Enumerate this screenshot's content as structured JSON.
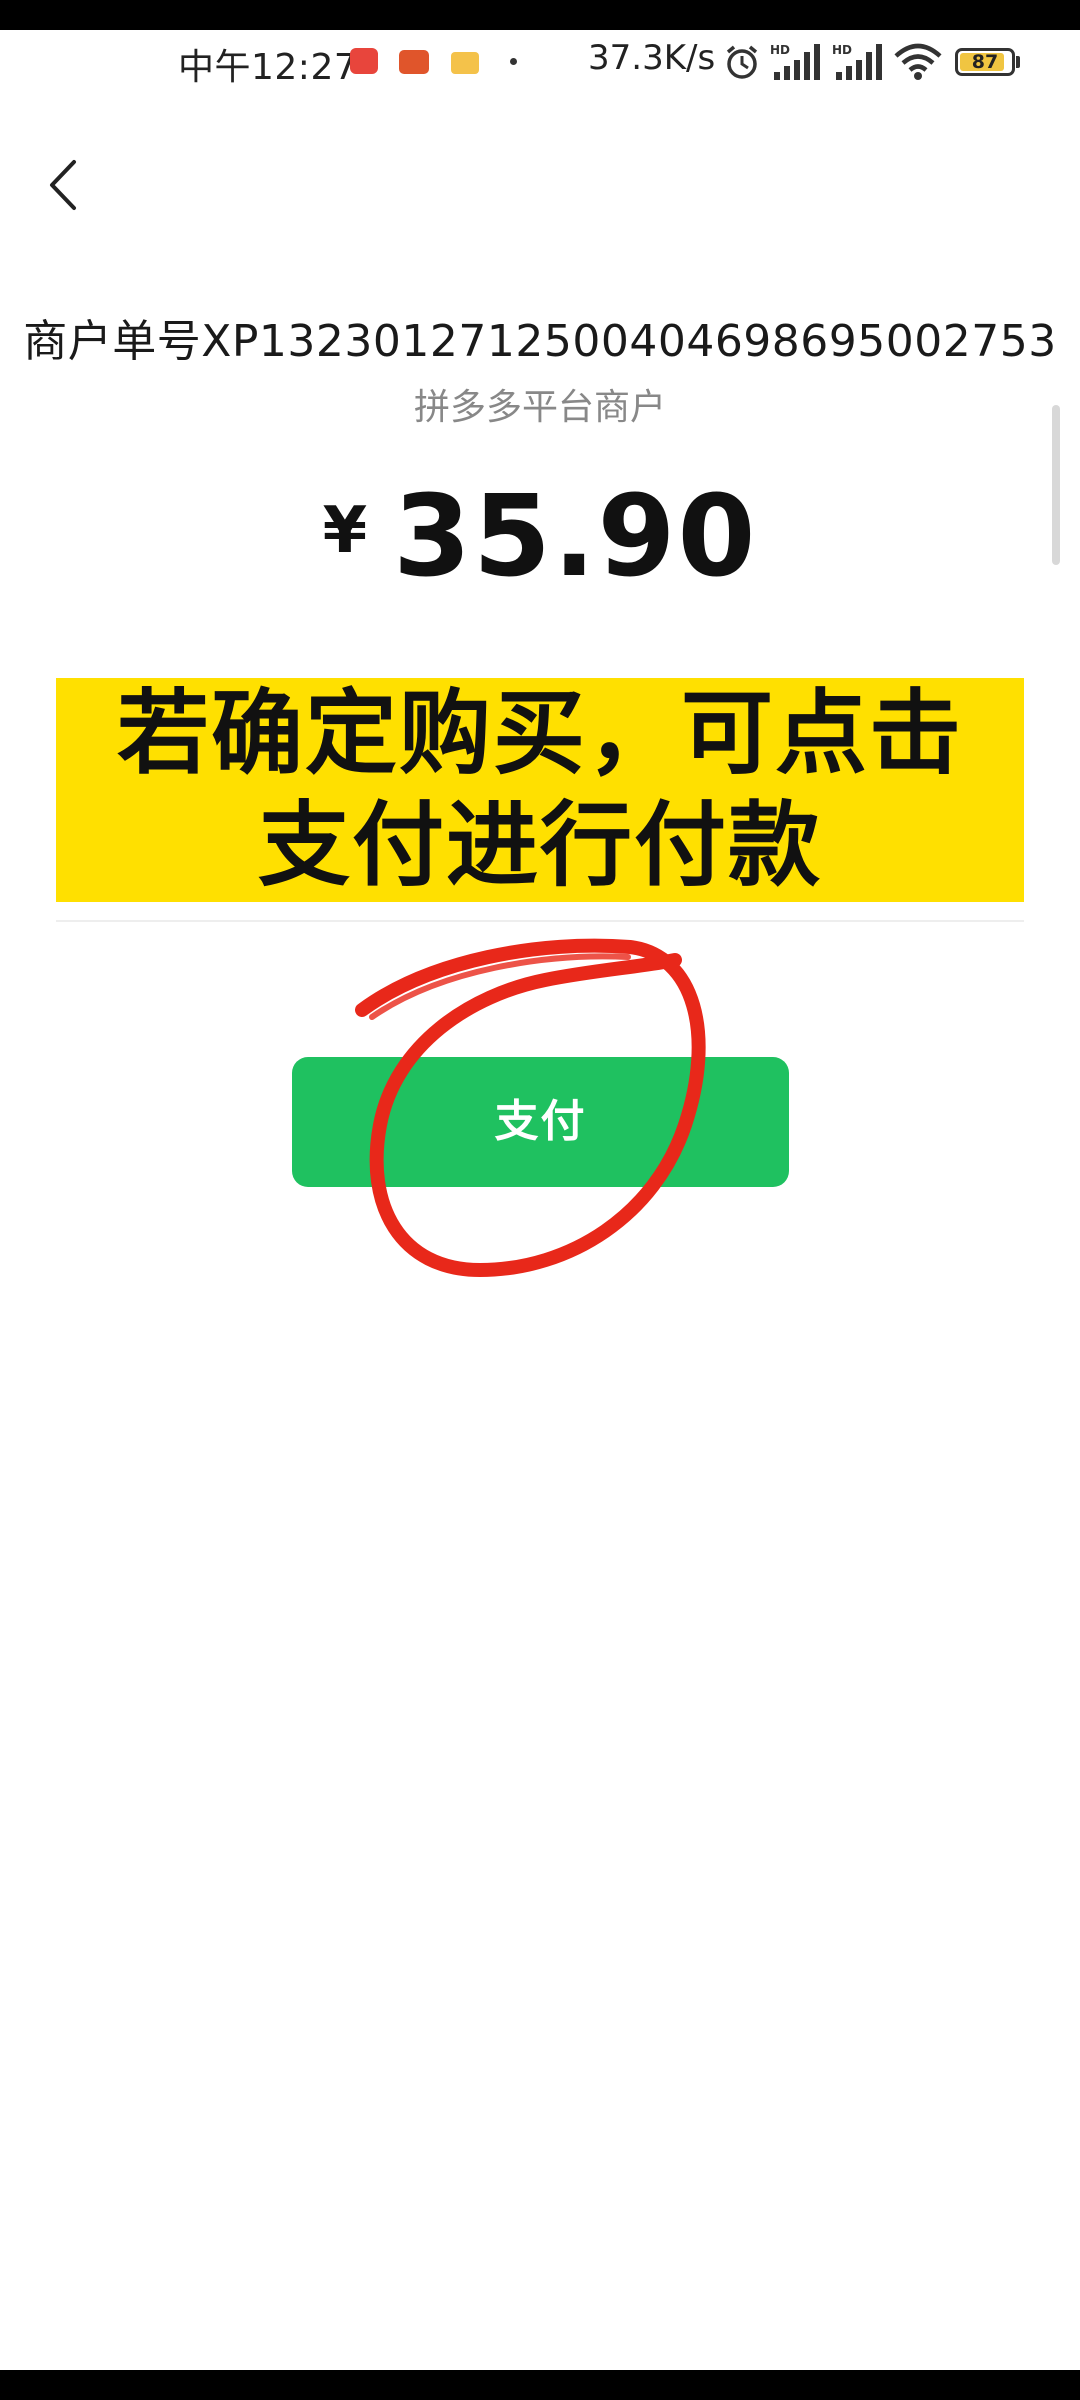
{
  "status_bar": {
    "time": "中午12:27",
    "network_speed": "37.3K/s",
    "battery_level": "87",
    "battery_fraction": 0.87,
    "icons": [
      "app-notification-icon",
      "video-icon",
      "message-icon",
      "alarm-icon",
      "hd-signal-icon",
      "hd-signal-icon",
      "wifi-icon",
      "battery-icon"
    ]
  },
  "nav": {
    "back_icon": "chevron-left-icon"
  },
  "payment": {
    "order_no": "商户单号XP1323012712500404698695002753",
    "merchant": "拼多多平台商户",
    "currency_symbol": "¥",
    "amount": "35.90"
  },
  "banner": {
    "line1": "若确定购买，可点击",
    "line2": "支付进行付款"
  },
  "actions": {
    "pay_label": "支付"
  },
  "colors": {
    "pay_button": "#1fc160",
    "banner_bg": "#ffe000",
    "annotation_circle": "#e8281a"
  }
}
